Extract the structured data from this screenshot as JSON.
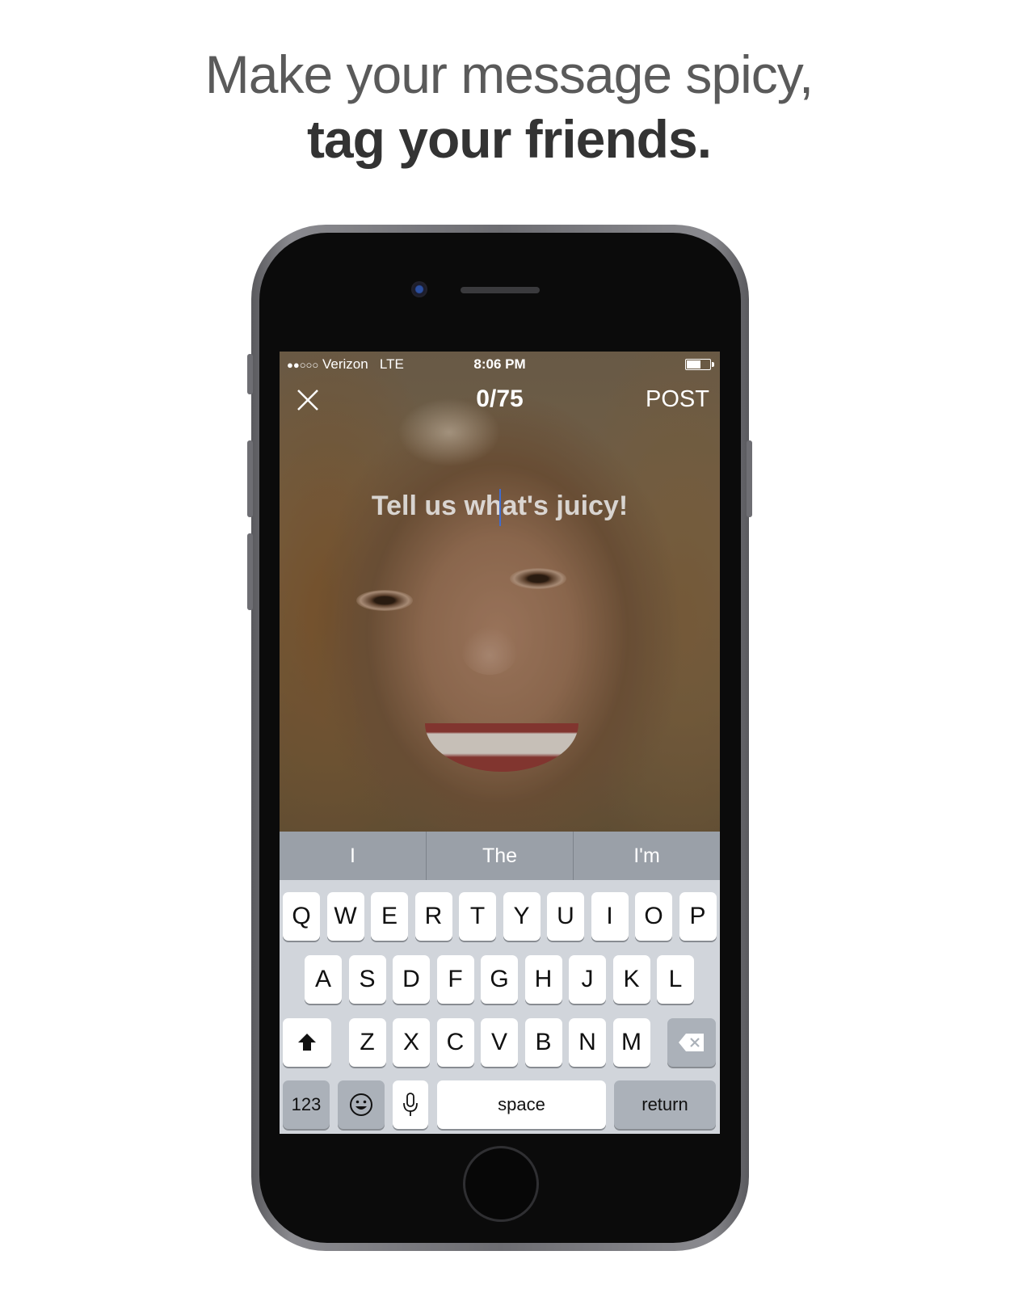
{
  "headline": {
    "line1": "Make your message spicy,",
    "line2": "tag your friends."
  },
  "status_bar": {
    "signal": "●●○○○",
    "carrier": "Verizon",
    "network": "LTE",
    "time": "8:06 PM"
  },
  "composer": {
    "counter": "0/75",
    "post_label": "POST",
    "placeholder": "Tell us what's juicy!",
    "value": ""
  },
  "suggestions": [
    "I",
    "The",
    "I'm"
  ],
  "keyboard": {
    "row1": [
      "Q",
      "W",
      "E",
      "R",
      "T",
      "Y",
      "U",
      "I",
      "O",
      "P"
    ],
    "row2": [
      "A",
      "S",
      "D",
      "F",
      "G",
      "H",
      "J",
      "K",
      "L"
    ],
    "row3": [
      "Z",
      "X",
      "C",
      "V",
      "B",
      "N",
      "M"
    ],
    "numbers_label": "123",
    "space_label": "space",
    "return_label": "return"
  },
  "colors": {
    "cursor": "#3f6dd1",
    "keyboard_bg": "#d1d5db",
    "suggestion_bar": "#9aa0a8"
  },
  "icons": [
    "close-icon",
    "shift-icon",
    "backspace-icon",
    "emoji-icon",
    "microphone-icon",
    "battery-icon"
  ]
}
